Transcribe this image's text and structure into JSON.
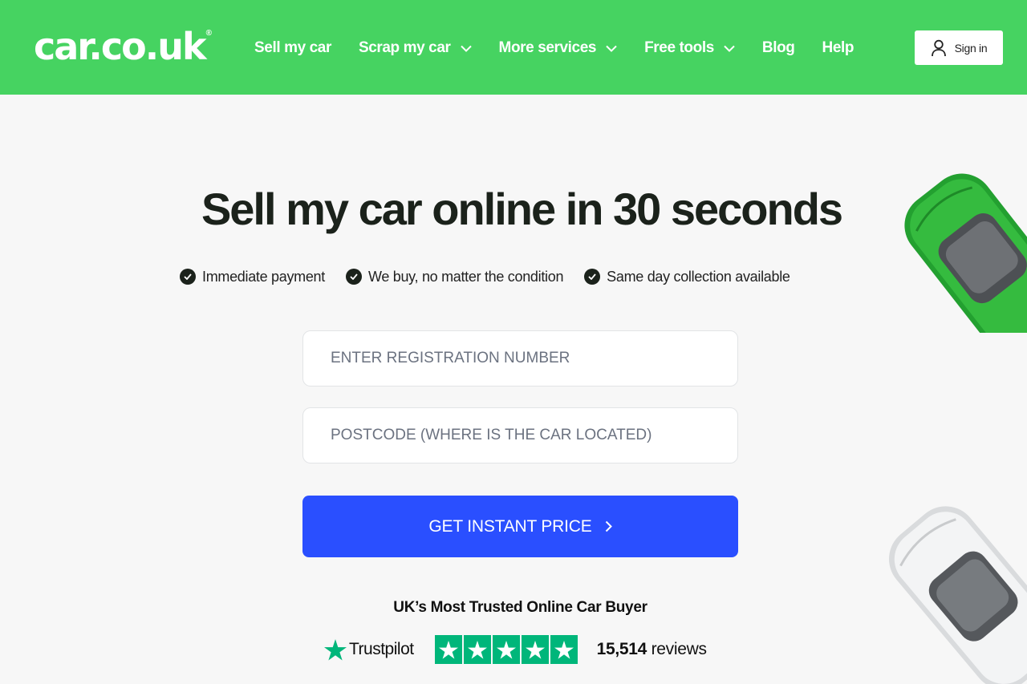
{
  "header": {
    "logo_text": "car.co.uk",
    "logo_mark": "®",
    "nav": [
      {
        "label": "Sell my car",
        "has_dropdown": false
      },
      {
        "label": "Scrap my car",
        "has_dropdown": true
      },
      {
        "label": "More services",
        "has_dropdown": true
      },
      {
        "label": "Free tools",
        "has_dropdown": true
      },
      {
        "label": "Blog",
        "has_dropdown": false
      },
      {
        "label": "Help",
        "has_dropdown": false
      }
    ],
    "signin_label": "Sign in"
  },
  "hero": {
    "title": "Sell my car online in 30 seconds",
    "benefits": [
      "Immediate payment",
      "We buy, no matter the condition",
      "Same day collection available"
    ]
  },
  "form": {
    "registration_placeholder": "ENTER REGISTRATION NUMBER",
    "postcode_placeholder": "POSTCODE (WHERE IS THE CAR LOCATED)",
    "cta_label": "GET INSTANT PRICE"
  },
  "trust": {
    "heading": "UK’s Most Trusted Online Car Buyer",
    "brand": "Trustpilot",
    "stars": 5,
    "review_count": "15,514",
    "review_word": "reviews"
  },
  "colors": {
    "brand_green": "#46d361",
    "cta_blue": "#2a4fff",
    "trustpilot_green": "#00b67a",
    "page_bg": "#f7f7f7"
  },
  "icons": [
    "user-icon",
    "chevron-down-icon",
    "check-circle-icon",
    "chevron-right-icon",
    "trustpilot-star-icon"
  ]
}
